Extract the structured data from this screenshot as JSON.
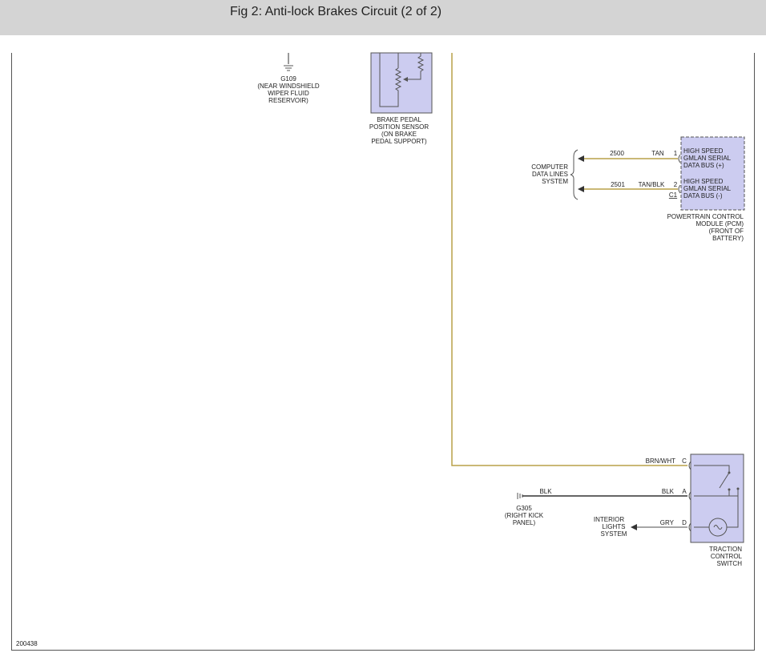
{
  "header": {
    "title": "Fig 2: Anti-lock Brakes Circuit (2 of 2)"
  },
  "colors": {
    "header_bg": "#d4d4d4",
    "component_fill": "#ccccf0",
    "wire_tan": "#b8a048",
    "wire_dark": "#555555"
  },
  "g109": {
    "id": "G109",
    "line1": "(NEAR WINDSHIELD",
    "line2": "WIPER FLUID",
    "line3": "RESERVOIR)"
  },
  "brake_sensor": {
    "line1": "BRAKE PEDAL",
    "line2": "POSITION SENSOR",
    "line3": "(ON BRAKE",
    "line4": "PEDAL SUPPORT)"
  },
  "data_lines": {
    "line1": "COMPUTER",
    "line2": "DATA LINES",
    "line3": "SYSTEM"
  },
  "wires": {
    "w1": {
      "circuit": "2500",
      "color": "TAN",
      "pin": "1"
    },
    "w2": {
      "circuit": "2501",
      "color": "TAN/BLK",
      "pin": "2",
      "connector": "C1"
    },
    "brn": {
      "color": "BRN/WHT",
      "pin": "C"
    },
    "blk_left": {
      "color": "BLK"
    },
    "blk": {
      "color": "BLK",
      "pin": "A"
    },
    "gry": {
      "color": "GRY",
      "pin": "D"
    }
  },
  "pcm": {
    "pin1_l1": "HIGH SPEED",
    "pin1_l2": "GMLAN SERIAL",
    "pin1_l3": "DATA BUS (+)",
    "pin2_l1": "HIGH SPEED",
    "pin2_l2": "GMLAN SERIAL",
    "pin2_l3": "DATA BUS (-)",
    "cap1": "POWERTRAIN CONTROL",
    "cap2": "MODULE (PCM)",
    "cap3": "(FRONT OF",
    "cap4": "BATTERY)"
  },
  "g305": {
    "id": "G305",
    "line1": "(RIGHT KICK",
    "line2": "PANEL)"
  },
  "interior": {
    "line1": "INTERIOR",
    "line2": "LIGHTS",
    "line3": "SYSTEM"
  },
  "traction": {
    "line1": "TRACTION",
    "line2": "CONTROL",
    "line3": "SWITCH"
  },
  "footer": {
    "code": "200438"
  }
}
